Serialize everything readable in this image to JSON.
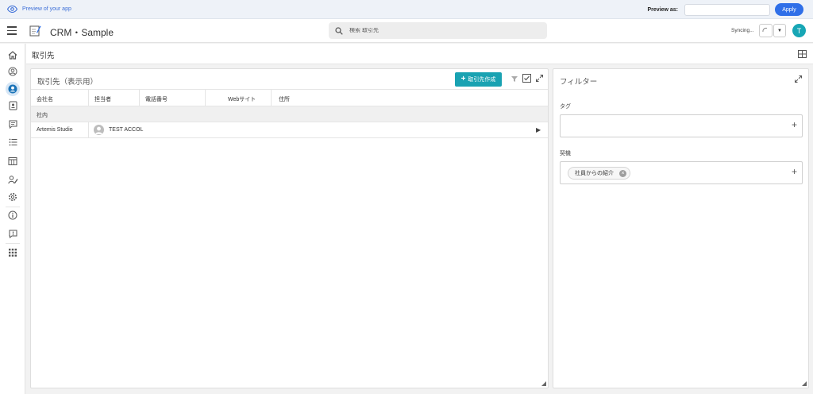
{
  "preview_bar": {
    "label": "Preview of your app",
    "preview_as_label": "Preview as:",
    "preview_as_value": "",
    "apply_label": "Apply"
  },
  "header": {
    "app_title": "CRM・Sample",
    "search_placeholder": "検索 取引先",
    "sync_status": "Syncing...",
    "avatar_initial": "T"
  },
  "nav": {
    "items": [
      "home-icon",
      "account-circle-icon",
      "contact-active-icon",
      "contact-book-icon",
      "chat-icon",
      "checklist-icon",
      "calendar-icon",
      "user-edit-icon",
      "settings-icon",
      "info-icon",
      "feedback-icon",
      "apps-grid-icon"
    ]
  },
  "page": {
    "title": "取引先"
  },
  "main_panel": {
    "title": "取引先（表示用）",
    "create_label": "取引先作成",
    "columns": [
      "会社名",
      "担当者",
      "電話番号",
      "Webサイト",
      "住所"
    ],
    "groups": [
      {
        "label": "社内",
        "rows": [
          {
            "company": "Artemis Studio",
            "owner": "TEST ACCOL"
          }
        ]
      }
    ]
  },
  "filter_panel": {
    "title": "フィルター",
    "tag_label": "タグ",
    "opportunity_label": "契機",
    "opportunity_chip": "社員からの紹介"
  },
  "colors": {
    "accent": "#19a2b2",
    "apply": "#2f6fe8",
    "avatar": "#17a6b5",
    "preview_link": "#3d6fd8"
  }
}
